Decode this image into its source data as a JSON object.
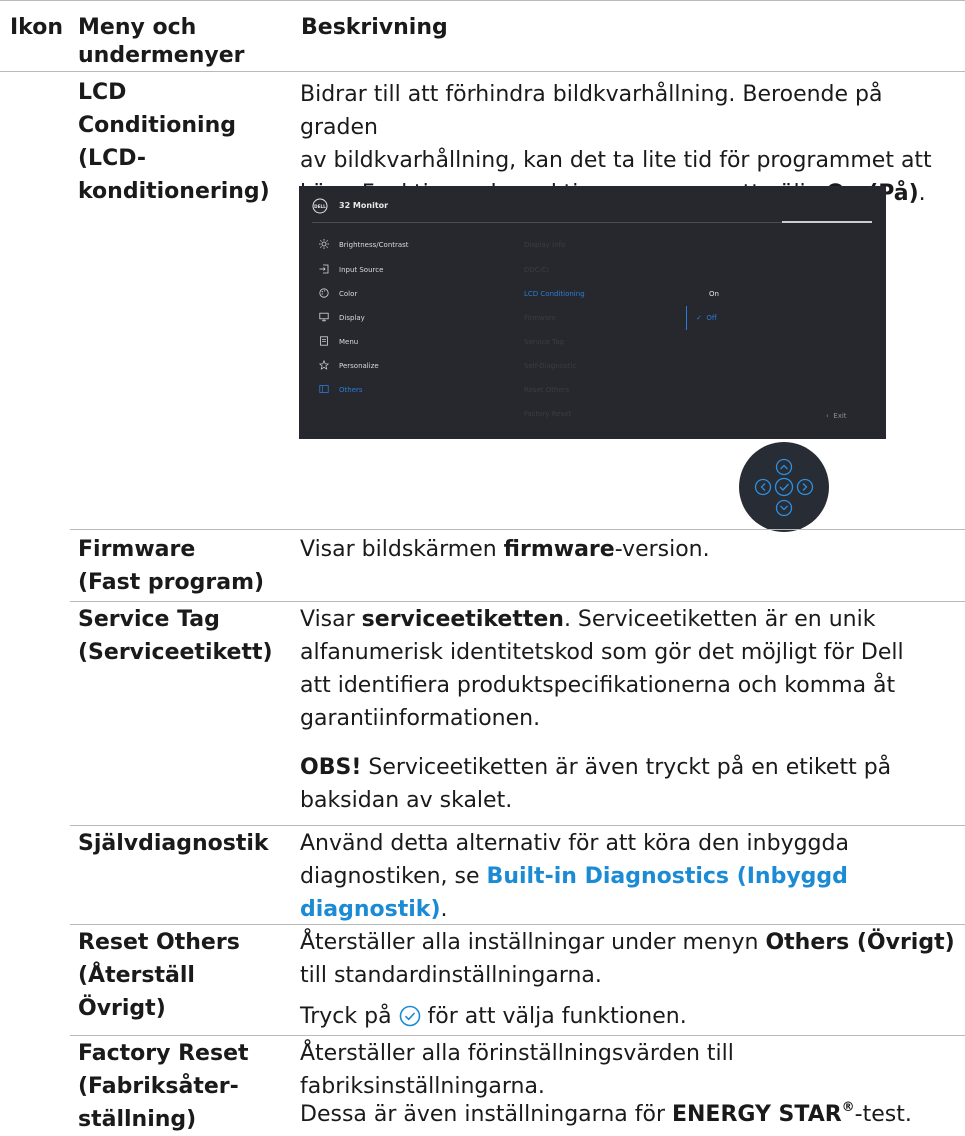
{
  "header": {
    "col_icon": "Ikon",
    "col_menu_line1": "Meny och",
    "col_menu_line2": "undermenyer",
    "col_desc": "Beskrivning"
  },
  "rows": {
    "lcd": {
      "label": [
        "LCD",
        "Conditioning",
        "(LCD-",
        "konditionering)"
      ],
      "desc_lines": [
        "Bidrar till att förhindra bildkvarhållning. Beroende på graden",
        "av bildkvarhållning, kan det ta lite tid för programmet att"
      ],
      "desc_last_pre": "köra. Funktionen kan aktiveras genom att välja ",
      "desc_last_bold": "On (På)",
      "desc_last_post": "."
    },
    "firmware": {
      "label": [
        "Firmware",
        "(Fast program)"
      ],
      "desc_pre": "Visar bildskärmen ",
      "desc_bold": "firmware",
      "desc_post": "-version."
    },
    "service_tag": {
      "label": [
        "Service Tag",
        "(Serviceetikett)"
      ],
      "desc_line1_pre": "Visar ",
      "desc_line1_bold": "serviceetiketten",
      "desc_line1_post": ". Serviceetiketten är en unik",
      "desc_lines": [
        "alfanumerisk identitetskod som gör det möjligt för Dell",
        "att identifiera produktspecifikationerna och komma åt",
        "garantiinformationen."
      ],
      "note_bold": "OBS!",
      "note_line1": " Serviceetiketten är även tryckt på en etikett på",
      "note_line2": "baksidan av skalet."
    },
    "self_diag": {
      "label": [
        "Självdiagnostik"
      ],
      "desc_line1": "Använd detta alternativ för att köra den inbyggda",
      "desc_line2_pre": "diagnostiken, se ",
      "desc_line2_link": "Built-in Diagnostics (Inbyggd",
      "desc_line3_link": "diagnostik)",
      "desc_line3_post": "."
    },
    "reset_others": {
      "label": [
        "Reset Others",
        "(Återställ Övrigt)"
      ],
      "desc_line1_pre": "Återställer alla inställningar under menyn ",
      "desc_line1_bold": "Others (Övrigt)",
      "desc_line2": "till standardinställningarna.",
      "press_pre": "Tryck på ",
      "press_post": " för att välja funktionen."
    },
    "factory_reset": {
      "label": [
        "Factory Reset",
        "(Fabriksåter-",
        "ställning)"
      ],
      "desc_line1": "Återställer alla förinställningsvärden till",
      "desc_line2": "fabriksinställningarna.",
      "energy_pre": "Dessa är även inställningarna för ",
      "energy_bold": "ENERGY STAR",
      "energy_sup": "®",
      "energy_post": "-test."
    }
  },
  "osd": {
    "title": "32 Monitor",
    "logo_text": "DELL",
    "menu": [
      "Brightness/Contrast",
      "Input Source",
      "Color",
      "Display",
      "Menu",
      "Personalize",
      "Others"
    ],
    "menu_icons": [
      "sun-icon",
      "input-icon",
      "palette-icon",
      "monitor-icon",
      "menu-icon",
      "star-icon",
      "others-icon"
    ],
    "submenu": [
      "Display Info",
      "DDC/CI",
      "LCD Conditioning",
      "Firmware",
      "Service Tag",
      "Self-Diagnostic",
      "Reset Others",
      "Factory Reset"
    ],
    "options": [
      "On",
      "Off"
    ],
    "exit": "Exit",
    "accent": "#2b7cd6"
  },
  "colors": {
    "link": "#1a8bd4",
    "rule": "#b9b9b9",
    "osd_bg": "#26282e"
  }
}
